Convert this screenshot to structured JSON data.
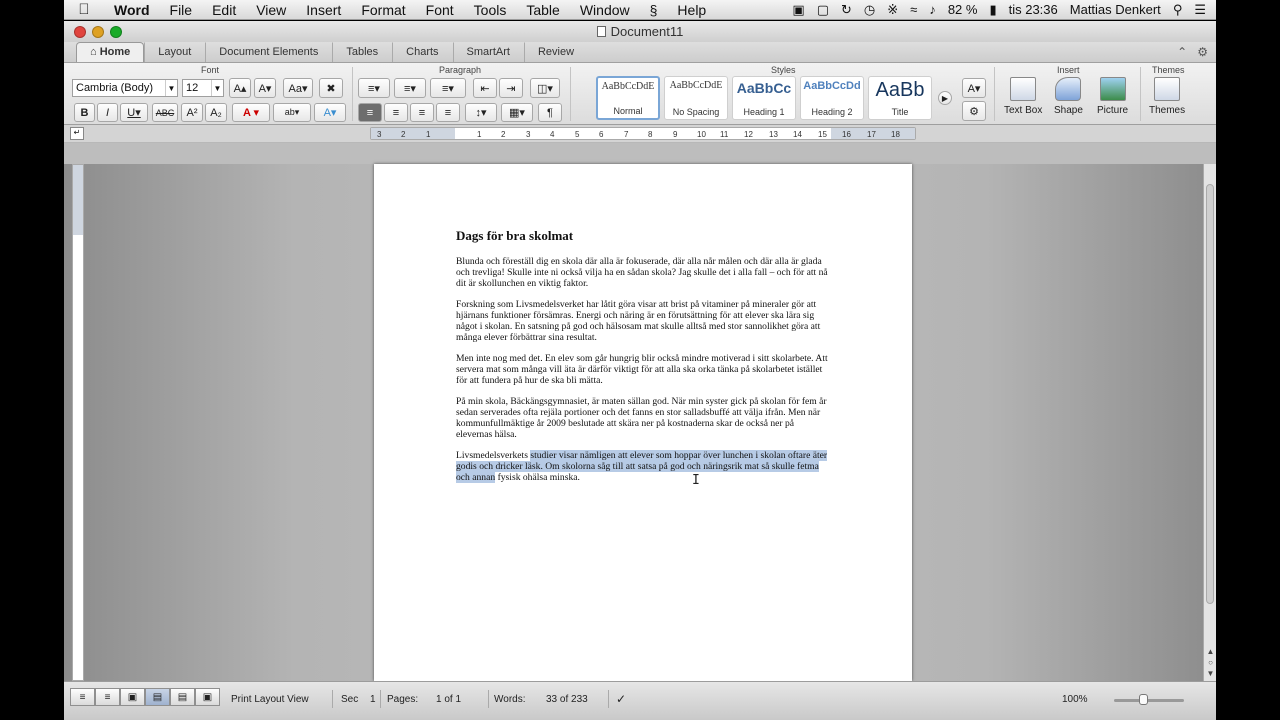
{
  "menubar": {
    "app": "Word",
    "items": [
      "File",
      "Edit",
      "View",
      "Insert",
      "Format",
      "Font",
      "Tools",
      "Table",
      "Window",
      "Help"
    ],
    "battery": "82 %",
    "clock": "tis 23:36",
    "user": "Mattias Denkert"
  },
  "window": {
    "title": "Document11"
  },
  "ribbon_tabs": [
    "Home",
    "Layout",
    "Document Elements",
    "Tables",
    "Charts",
    "SmartArt",
    "Review"
  ],
  "ribbon": {
    "groups": {
      "font": "Font",
      "paragraph": "Paragraph",
      "styles": "Styles",
      "insert": "Insert",
      "themes": "Themes"
    },
    "font_name": "Cambria (Body)",
    "font_size": "12",
    "styles": [
      {
        "sample": "AaBbCcDdE",
        "name": "Normal"
      },
      {
        "sample": "AaBbCcDdE",
        "name": "No Spacing"
      },
      {
        "sample": "AaBbCc",
        "name": "Heading 1"
      },
      {
        "sample": "AaBbCcDd",
        "name": "Heading 2"
      },
      {
        "sample": "AaBb",
        "name": "Title"
      }
    ],
    "insert_items": [
      "Text Box",
      "Shape",
      "Picture"
    ],
    "themes_label": "Themes"
  },
  "ruler": {
    "ticks": [
      "3",
      "2",
      "1",
      "1",
      "2",
      "3",
      "4",
      "5",
      "6",
      "7",
      "8",
      "9",
      "10",
      "11",
      "12",
      "13",
      "14",
      "15",
      "16",
      "17",
      "18"
    ]
  },
  "document": {
    "heading": "Dags för bra skolmat",
    "paragraphs": [
      "Blunda och föreställ dig en skola där alla är fokuserade, där alla når målen och där alla är glada och trevliga! Skulle inte ni också vilja ha en sådan skola? Jag skulle det i alla fall – och för att nå dit är skollunchen en viktig faktor.",
      "Forskning som Livsmedelsverket har låtit göra visar att brist på vitaminer på mineraler gör att hjärnans funktioner försämras. Energi och näring är en förutsättning för att elever ska lära sig något i skolan. En satsning på god och hälsosam mat skulle alltså med stor sannolikhet göra att många elever förbättrar sina resultat.",
      "Men inte nog med det. En elev som går hungrig blir också mindre motiverad i sitt skolarbete. Att servera mat som många vill äta är därför viktigt för att alla ska orka tänka på skolarbetet istället för att fundera på hur de ska bli mätta.",
      "På min skola, Bäckängsgymnasiet, är maten sällan god. När min syster gick på skolan för fem år sedan serverades ofta rejäla portioner och det fanns en stor salladsbuffé att välja ifrån. Men när kommunfullmäktige år 2009 beslutade att skära ner på kostnaderna skar de också ner på elevernas hälsa."
    ],
    "last_paragraph": {
      "before": "Livsmedelsverkets ",
      "selected": "studier visar nämligen att elever som hoppar över lunchen i skolan oftare äter godis och dricker läsk. Om skolorna såg till att satsa på god och näringsrik mat så skulle fetma och annan",
      "after": " fysisk ohälsa minska."
    }
  },
  "statusbar": {
    "view": "Print Layout View",
    "sec_label": "Sec",
    "sec_value": "1",
    "pages_label": "Pages:",
    "pages_value": "1 of 1",
    "words_label": "Words:",
    "words_value": "33 of 233",
    "zoom": "100%"
  },
  "colors": {
    "selection_highlight": "#b7cbe6",
    "close": "#e0443e",
    "minimize": "#dea123",
    "zoom": "#1aab29"
  }
}
